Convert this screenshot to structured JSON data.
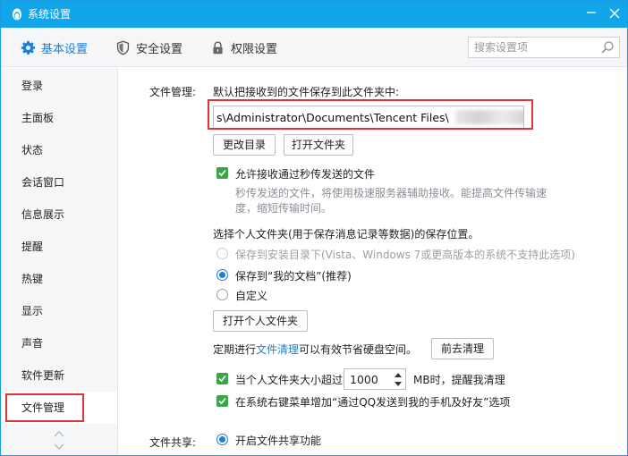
{
  "window": {
    "title": "系统设置",
    "min_icon": "minimize-icon",
    "close_icon": "close-icon",
    "accent": "#12a5ea"
  },
  "tabs": [
    {
      "label": "基本设置",
      "icon": "gear-icon",
      "active": true
    },
    {
      "label": "安全设置",
      "icon": "shield-icon"
    },
    {
      "label": "权限设置",
      "icon": "lock-icon"
    }
  ],
  "search": {
    "placeholder": "搜索设置项",
    "icon": "search-icon"
  },
  "sidebar": {
    "items": [
      {
        "label": "登录"
      },
      {
        "label": "主面板"
      },
      {
        "label": "状态"
      },
      {
        "label": "会话窗口"
      },
      {
        "label": "信息展示"
      },
      {
        "label": "提醒"
      },
      {
        "label": "热键"
      },
      {
        "label": "显示"
      },
      {
        "label": "声音"
      },
      {
        "label": "软件更新"
      },
      {
        "label": "文件管理",
        "active": true
      }
    ]
  },
  "file_mgmt": {
    "section_label": "文件管理:",
    "save_desc": "默认把接收到的文件保存到此文件夹中:",
    "path_value": "s\\Administrator\\Documents\\Tencent Files\\",
    "change_dir_label": "更改目录",
    "open_folder_label": "打开文件夹",
    "allow_flash_label": "允许接收通过秒传发送的文件",
    "allow_flash_desc_1": "秒传发送的文件，将使用极速服务器辅助接收。能提高文件传输速",
    "allow_flash_desc_2": "度，缩短传输时间。",
    "personal_folder_title": "选择个人文件夹(用于保存消息记录等数据)的保存位置。",
    "opt_install_dir": "保存到安装目录下(Vista、Windows 7或更高版本的系统不支持此选项)",
    "opt_my_docs": "保存到“我的文档”(推荐)",
    "opt_custom": "自定义",
    "open_personal_label": "打开个人文件夹",
    "cleanup_pre": "定期进行",
    "cleanup_link": "文件清理",
    "cleanup_post": "可以有效节省硬盘空间。",
    "go_clean_label": "前去清理",
    "size_limit_label": "当个人文件夹大小超过",
    "size_limit_value": "1000",
    "size_limit_unit": "MB时，提醒我清理",
    "context_menu_label": "在系统右键菜单增加“通过QQ发送到我的手机及好友”选项"
  },
  "file_share": {
    "section_label": "文件共享:",
    "enable_label": "开启文件共享功能"
  }
}
